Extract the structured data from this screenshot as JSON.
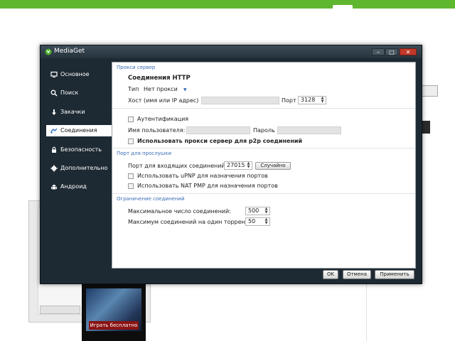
{
  "window": {
    "title": "MediaGet"
  },
  "sidebar": {
    "items": [
      {
        "label": "Основное",
        "icon": "monitor-icon"
      },
      {
        "label": "Поиск",
        "icon": "search-icon"
      },
      {
        "label": "Закачки",
        "icon": "download-arrow-icon"
      },
      {
        "label": "Соединения",
        "icon": "connection-icon",
        "active": true
      },
      {
        "label": "Безопасность",
        "icon": "lock-icon"
      },
      {
        "label": "Дополнительно",
        "icon": "gear-icon"
      },
      {
        "label": "Андроид",
        "icon": "android-icon"
      }
    ]
  },
  "proxy": {
    "section": "Прокси сервер",
    "http_title": "Соединения HTTP",
    "type_label": "Тип",
    "type_value": "Нет прокси",
    "host_label": "Хост (имя или IP адрес)",
    "host_value": "",
    "port_label": "Порт",
    "port_value": "3128",
    "auth_label": "Аутентификация",
    "auth_checked": false,
    "username_label": "Имя пользователя:",
    "username_value": "",
    "password_label": "Пароль",
    "password_value": "",
    "p2p_label": "Использовать прокси сервер для p2p соединений",
    "p2p_checked": false
  },
  "listen": {
    "section": "Порт для прослушки",
    "incoming_label": "Порт для входящих соединений:",
    "incoming_value": "27015",
    "random_button": "Случайно",
    "upnp_label": "Использовать uPNP для назначения портов",
    "upnp_checked": false,
    "natpmp_label": "Использовать NAT PMP для назначения портов",
    "natpmp_checked": false
  },
  "limits": {
    "section": "Ограничение соединений",
    "max_label": "Максимальное число соединений:",
    "max_value": "500",
    "per_torrent_label": "Максимум соединений на один торрент:",
    "per_torrent_value": "50"
  },
  "buttons": {
    "ok": "OK",
    "cancel": "Отмена",
    "apply": "Применить"
  },
  "background": {
    "game_button": "Играть бесплатно"
  },
  "colors": {
    "brand_green": "#5fb72f",
    "window_dark": "#1e2a33",
    "section_blue": "#3a6db5",
    "close_red": "#c23a2a"
  }
}
